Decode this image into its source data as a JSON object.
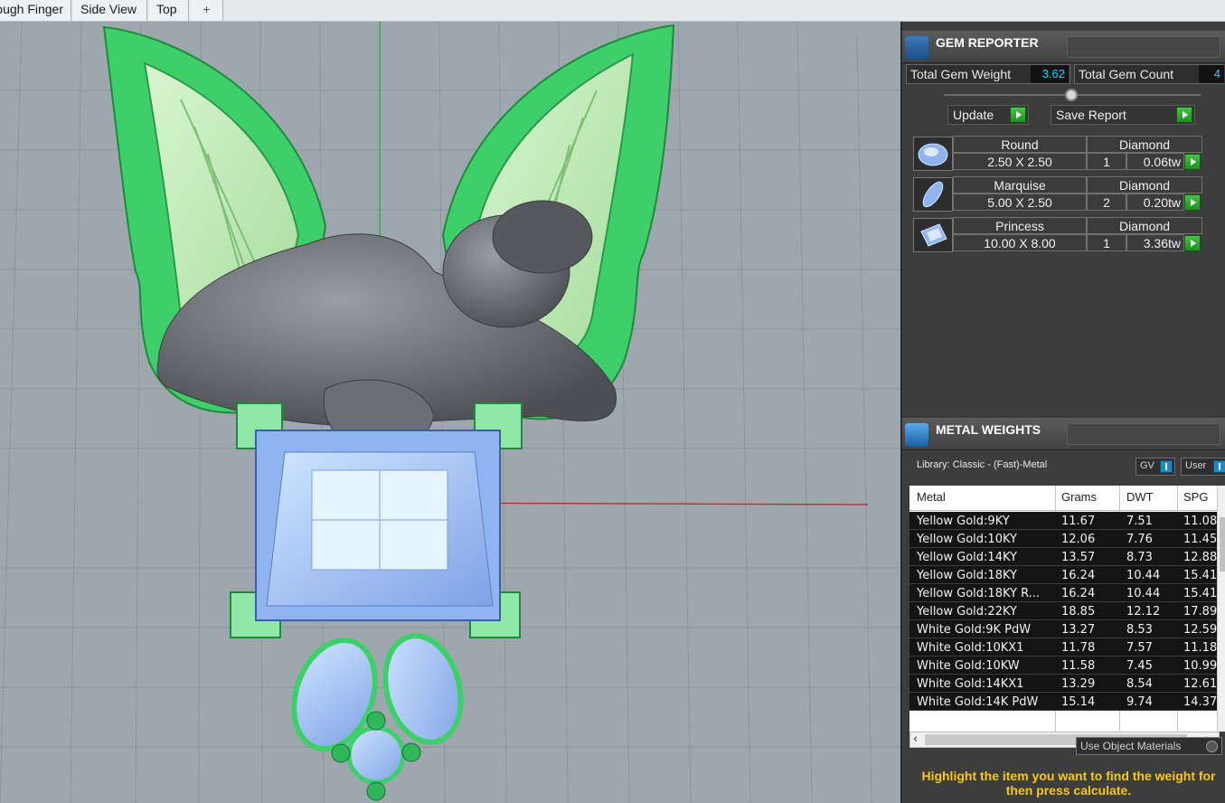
{
  "tabs": [
    "Rough Finger",
    "Side View",
    "Top",
    "+"
  ],
  "gem_reporter": {
    "title": "GEM REPORTER",
    "total_weight_label": "Total Gem Weight",
    "total_weight_value": "3.62",
    "total_count_label": "Total Gem Count",
    "total_count_value": "4",
    "update_label": "Update",
    "save_label": "Save Report",
    "gems": [
      {
        "shape": "Round",
        "material": "Diamond",
        "size": "2.50 X 2.50",
        "qty": "1",
        "weight": "0.06tw"
      },
      {
        "shape": "Marquise",
        "material": "Diamond",
        "size": "5.00 X 2.50",
        "qty": "2",
        "weight": "0.20tw"
      },
      {
        "shape": "Princess",
        "material": "Diamond",
        "size": "10.00 X 8.00",
        "qty": "1",
        "weight": "3.36tw"
      }
    ]
  },
  "metal_weights": {
    "title": "METAL WEIGHTS",
    "library_label": "Library: Classic - (Fast)-Metal",
    "gv_label": "GV",
    "user_label": "User",
    "columns": [
      "Metal",
      "Grams",
      "DWT",
      "SPG"
    ],
    "rows": [
      [
        "Yellow Gold:9KY",
        "11.67",
        "7.51",
        "11.08"
      ],
      [
        "Yellow Gold:10KY",
        "12.06",
        "7.76",
        "11.45"
      ],
      [
        "Yellow Gold:14KY",
        "13.57",
        "8.73",
        "12.88"
      ],
      [
        "Yellow Gold:18KY",
        "16.24",
        "10.44",
        "15.41"
      ],
      [
        "Yellow Gold:18KY R...",
        "16.24",
        "10.44",
        "15.41"
      ],
      [
        "Yellow Gold:22KY",
        "18.85",
        "12.12",
        "17.89"
      ],
      [
        "White Gold:9K PdW",
        "13.27",
        "8.53",
        "12.59"
      ],
      [
        "White Gold:10KX1",
        "11.78",
        "7.57",
        "11.18"
      ],
      [
        "White Gold:10KW",
        "11.58",
        "7.45",
        "10.99"
      ],
      [
        "White Gold:14KX1",
        "13.29",
        "8.54",
        "12.61"
      ],
      [
        "White Gold:14K PdW",
        "15.14",
        "9.74",
        "14.37"
      ]
    ],
    "use_object_materials": "Use Object Materials",
    "hint": "Highlight the item you want to find the weight for then press calculate."
  },
  "colors": {
    "viewport_bg": "#9ea7ae",
    "wing_green": "#3fcf6a",
    "gem_blue": "#8fb4f0",
    "figure_gray": "#5f6266",
    "accent_cyan": "#25d0ff",
    "hint_yellow": "#f6c81b"
  }
}
